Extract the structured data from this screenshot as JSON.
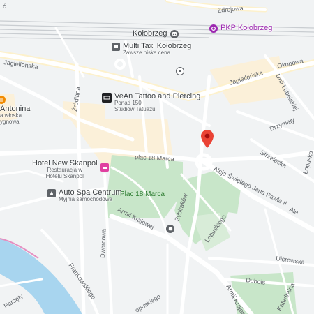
{
  "map": {
    "colors": {
      "background": "#f1f3f4",
      "road": "#ffffff",
      "major_road": "#fdf1cc",
      "park": "#c8e6c9",
      "water": "#a8d5ef",
      "highlight_area": "#fbf0d9",
      "rail": "#c0c4c8",
      "marker": "#ea4335",
      "poi_dark": "#5f6368",
      "poi_purple": "#9c27b0",
      "poi_orange": "#f28b00",
      "poi_black": "#202124",
      "poi_pink": "#e040a0"
    },
    "streets": {
      "zdrojowa": "Zdrojowa",
      "jagiellonska_west": "Jagiellońska",
      "jagiellonska_east": "Jagiellońska",
      "okopowa": "Okopowa",
      "unii_lubelskiej": "Unii Lubelskiej",
      "zrodlana": "Źródlana",
      "drzymaly": "Drzymały",
      "strzelecka": "Strzelecka",
      "lopuska_east": "Łopuska",
      "plac_18_marca_street": "plac 18 Marca",
      "aleja_jp2": "Aleja Świętego Jana Pawła II",
      "aleja_short": "Ale",
      "armii_krajowej_west": "Armii Krajowej",
      "armii_krajowej_south": "Armii Krajowej",
      "sybirakow": "Sybiraków",
      "dworcowa": "Dworcowa",
      "lopuskiego": "Łopuskiego",
      "ulcrowska": "Ułcrowska",
      "dubois": "Dubois",
      "frankowskiego": "Frankowskiego",
      "katedralna": "Katedralna",
      "lopuskie_bottom": "opuskiego",
      "parsety": "Parsęty",
      "bulwar": "ć"
    },
    "pois": {
      "kolobrzeg_station": {
        "name": "Kołobrzeg",
        "icon": "train-station-icon"
      },
      "pkp": {
        "name": "PKP Kołobrzeg",
        "icon": "pkp-icon"
      },
      "taxi": {
        "name": "Multi Taxi Kołobrzeg",
        "sub": "Zawsze niska cena",
        "icon": "taxi-icon"
      },
      "tattoo": {
        "name": "VeAn Tattoo and Piercing",
        "sub1": "Ponad 150",
        "sub2": "Studiów Tatuażu",
        "icon": "tattoo-icon"
      },
      "antonina": {
        "name": "Antonina",
        "sub1": "a włoska",
        "sub2": "ygnowa",
        "icon": "restaurant-icon"
      },
      "hotel": {
        "name": "Hotel New Skanpol",
        "sub1": "Restauracja w",
        "sub2": "Hotelu Skanpol",
        "icon": "hotel-icon"
      },
      "autospa": {
        "name": "Auto Spa Centrum",
        "sub": "Myjnia samochodowa",
        "icon": "car-wash-icon"
      },
      "bus": {
        "icon": "bus-stop-icon"
      },
      "train_small": {
        "icon": "train-icon"
      }
    },
    "place_label": "Plac 18 Marca",
    "marker": {
      "icon": "location-pin-icon"
    }
  }
}
